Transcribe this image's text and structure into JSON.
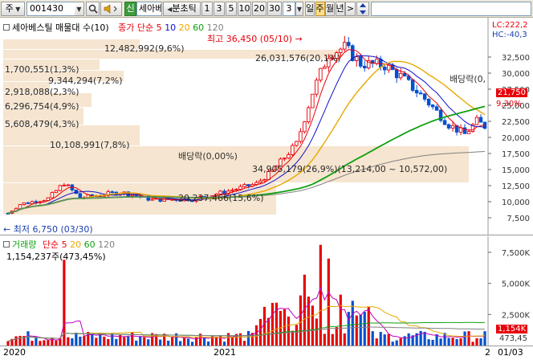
{
  "toolbar": {
    "market_type": "주",
    "stock_code": "001430",
    "stock_name": "세아베",
    "period_button": "분초틱",
    "interval_options": [
      "1",
      "3",
      "5",
      "10",
      "20",
      "30"
    ],
    "interval_input": "3",
    "period_tabs": [
      "일",
      "주",
      "월",
      "년"
    ],
    "active_period": "주",
    "credit_badge": "신"
  },
  "price_legend": {
    "title": "세아베스틸 매물대 수(10)",
    "ma_label": "종가 단순",
    "ma_periods": [
      "5",
      "10",
      "20",
      "60",
      "120"
    ]
  },
  "price_axis_labels": {
    "lc": "LC:222,2",
    "hc": "HC:-40,3",
    "current_price": "21,750",
    "current_change": "9,30%",
    "ticks": [
      "32,500",
      "30,000",
      "27,500",
      "25,000",
      "22,500",
      "20,000",
      "17,500",
      "15,000",
      "12,500",
      "10,000",
      "7,500"
    ]
  },
  "annotations": {
    "high": "최고 36,450 (05/10)",
    "low": "최저 6,750 (03/30)",
    "dividend_1": "배당락(0,00%)",
    "dividend_2": "배당락(0,"
  },
  "volume_profile": [
    {
      "label": "12,482,992(9,6%)"
    },
    {
      "label": "26,031,576(20,1%)"
    },
    {
      "label": "1,700,551(1,3%)"
    },
    {
      "label": "9,344,294(7,2%)"
    },
    {
      "label": "2,918,088(2,3%)"
    },
    {
      "label": "6,296,754(4,9%)"
    },
    {
      "label": "5,608,479(4,3%)"
    },
    {
      "label": "10,108,991(7,8%)"
    },
    {
      "label": "34,905,179(26,9%)(13,214,00 ~ 10,572,00)"
    },
    {
      "label": "20,237,466(15,6%)"
    }
  ],
  "volume_legend": {
    "title": "거래량",
    "ma_label": "단순",
    "ma_periods": [
      "5",
      "20",
      "60",
      "120"
    ],
    "current_volume": "1,154,237주(473,45%)"
  },
  "volume_axis_labels": {
    "ticks": [
      "7,500K",
      "5,000K",
      "2,500K"
    ],
    "current": "1,154K",
    "current_pct": "473,45"
  },
  "time_axis": {
    "labels": [
      "2020",
      "2021",
      "2"
    ],
    "date": "01/03"
  },
  "colors": {
    "up": "#e8000b",
    "down": "#0050d0",
    "ma5": "#e8000b",
    "ma10": "#1010c8",
    "ma20": "#e8a800",
    "ma60": "#10a010",
    "ma120": "#808080",
    "profile": "#f5e1c8"
  }
}
